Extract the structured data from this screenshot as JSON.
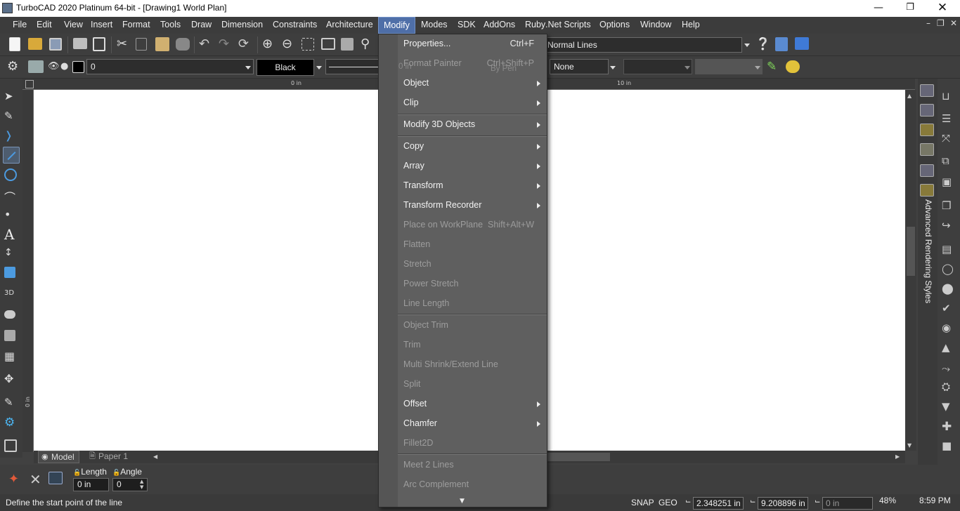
{
  "window": {
    "title": "TurboCAD 2020 Platinum 64-bit - [Drawing1 World Plan]"
  },
  "menubar": {
    "items": [
      "File",
      "Edit",
      "View",
      "Insert",
      "Format",
      "Tools",
      "Draw",
      "Dimension",
      "Constraints",
      "Architecture",
      "Modify",
      "Modes",
      "SDK",
      "AddOns",
      "Ruby",
      ".Net Scripts",
      "Options",
      "Window",
      "Help"
    ],
    "active": "Modify"
  },
  "toolbar": {
    "style_value": "Normal Lines",
    "layer_value": "0",
    "color_value": "Black",
    "fill_value": "None",
    "ghost_pen": "By Pen",
    "ghost_size": "0 in"
  },
  "ruler": {
    "label_0": "0 in",
    "label_10": "10 in",
    "left_label": "0 in"
  },
  "modify_menu": {
    "items": [
      {
        "label": "Properties...",
        "shortcut": "Ctrl+F",
        "submenu": false,
        "enabled": true
      },
      {
        "label": "Format Painter",
        "shortcut": "Ctrl+Shift+P",
        "submenu": false,
        "enabled": false
      },
      {
        "label": "Object",
        "shortcut": "",
        "submenu": true,
        "enabled": true
      },
      {
        "label": "Clip",
        "shortcut": "",
        "submenu": true,
        "enabled": true
      },
      {
        "label": "Modify 3D Objects",
        "shortcut": "",
        "submenu": true,
        "enabled": true
      },
      {
        "label": "Copy",
        "shortcut": "",
        "submenu": true,
        "enabled": true
      },
      {
        "label": "Array",
        "shortcut": "",
        "submenu": true,
        "enabled": true
      },
      {
        "label": "Transform",
        "shortcut": "",
        "submenu": true,
        "enabled": true
      },
      {
        "label": "Transform Recorder",
        "shortcut": "",
        "submenu": true,
        "enabled": true
      },
      {
        "label": "Place on WorkPlane",
        "shortcut": "Shift+Alt+W",
        "submenu": false,
        "enabled": false
      },
      {
        "label": "Flatten",
        "shortcut": "",
        "submenu": false,
        "enabled": false
      },
      {
        "label": "Stretch",
        "shortcut": "",
        "submenu": false,
        "enabled": false
      },
      {
        "label": "Power Stretch",
        "shortcut": "",
        "submenu": false,
        "enabled": false
      },
      {
        "label": "Line Length",
        "shortcut": "",
        "submenu": false,
        "enabled": false
      },
      {
        "label": "Object Trim",
        "shortcut": "",
        "submenu": false,
        "enabled": false
      },
      {
        "label": "Trim",
        "shortcut": "",
        "submenu": false,
        "enabled": false
      },
      {
        "label": "Multi Shrink/Extend Line",
        "shortcut": "",
        "submenu": false,
        "enabled": false
      },
      {
        "label": "Split",
        "shortcut": "",
        "submenu": false,
        "enabled": false
      },
      {
        "label": "Offset",
        "shortcut": "",
        "submenu": true,
        "enabled": true
      },
      {
        "label": "Chamfer",
        "shortcut": "",
        "submenu": true,
        "enabled": true
      },
      {
        "label": "Fillet2D",
        "shortcut": "",
        "submenu": false,
        "enabled": false
      },
      {
        "label": "Meet 2 Lines",
        "shortcut": "",
        "submenu": false,
        "enabled": false
      },
      {
        "label": "Arc Complement",
        "shortcut": "",
        "submenu": false,
        "enabled": false
      }
    ]
  },
  "right_panel": {
    "label": "Advanced Rendering Styles"
  },
  "tabs": {
    "model": "Model",
    "paper": "Paper 1"
  },
  "inputbar": {
    "length_label": "Length",
    "angle_label": "Angle",
    "length_value": "0 in",
    "angle_value": "0"
  },
  "status": {
    "prompt": "Define the start point of the line",
    "snap": "SNAP",
    "geo": "GEO",
    "x": "2.348251 in",
    "y": "9.208896 in",
    "z": "0 in",
    "zoom": "48%",
    "time": "8:59 PM"
  },
  "colors": {
    "accent": "#4f6fa8",
    "menu_bg": "#5f5f5f",
    "canvas": "#ffffff",
    "chrome": "#3e3e3e"
  }
}
